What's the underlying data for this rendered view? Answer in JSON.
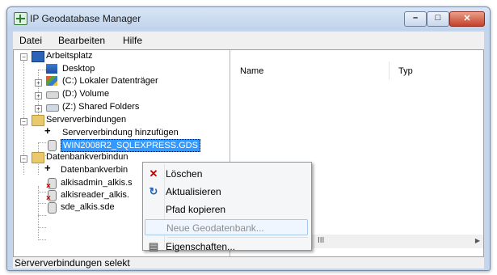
{
  "window": {
    "title": "IP Geodatabase Manager"
  },
  "menubar": {
    "items": [
      "Datei",
      "Bearbeiten",
      "Hilfe"
    ]
  },
  "tree": {
    "items": [
      {
        "label": "Arbeitsplatz",
        "icon": "computer-icon"
      },
      {
        "label": "Desktop",
        "icon": "desktop-icon"
      },
      {
        "label": "(C:) Lokaler Datenträger",
        "icon": "local-drive-icon"
      },
      {
        "label": "(D:) Volume",
        "icon": "drive-icon"
      },
      {
        "label": "(Z:) Shared Folders",
        "icon": "network-drive-icon"
      },
      {
        "label": "Serververbindungen",
        "icon": "folder-icon"
      },
      {
        "label": "Serververbindung hinzufügen",
        "icon": "add-connection-icon"
      },
      {
        "label": "WIN2008R2_SQLEXPRESS.GDS",
        "icon": "server-connection-icon"
      },
      {
        "label": "Datenbankverbindun",
        "icon": "folder-icon"
      },
      {
        "label": "Datenbankverbin",
        "icon": "add-connection-icon"
      },
      {
        "label": "alkisadmin_alkis.s",
        "icon": "database-error-icon"
      },
      {
        "label": "alkisreader_alkis.",
        "icon": "database-error-icon"
      },
      {
        "label": "sde_alkis.sde",
        "icon": "database-icon"
      }
    ]
  },
  "list": {
    "columns": [
      "Name",
      "Typ"
    ],
    "scroll_glyph": "III"
  },
  "status": {
    "text": "Serververbindungen selekt"
  },
  "context_menu": {
    "items": [
      {
        "label": "Löschen",
        "icon": "delete-icon",
        "enabled": true
      },
      {
        "label": "Aktualisieren",
        "icon": "refresh-icon",
        "enabled": true
      },
      {
        "label": "Pfad kopieren",
        "icon": "",
        "enabled": true
      },
      {
        "label": "Neue Geodatenbank...",
        "icon": "",
        "enabled": false
      },
      {
        "label": "Eigenschaften...",
        "icon": "properties-icon",
        "enabled": true
      }
    ]
  },
  "colors": {
    "selection": "#3399ff",
    "delete": "#c00000",
    "refresh": "#1f5fb5"
  }
}
